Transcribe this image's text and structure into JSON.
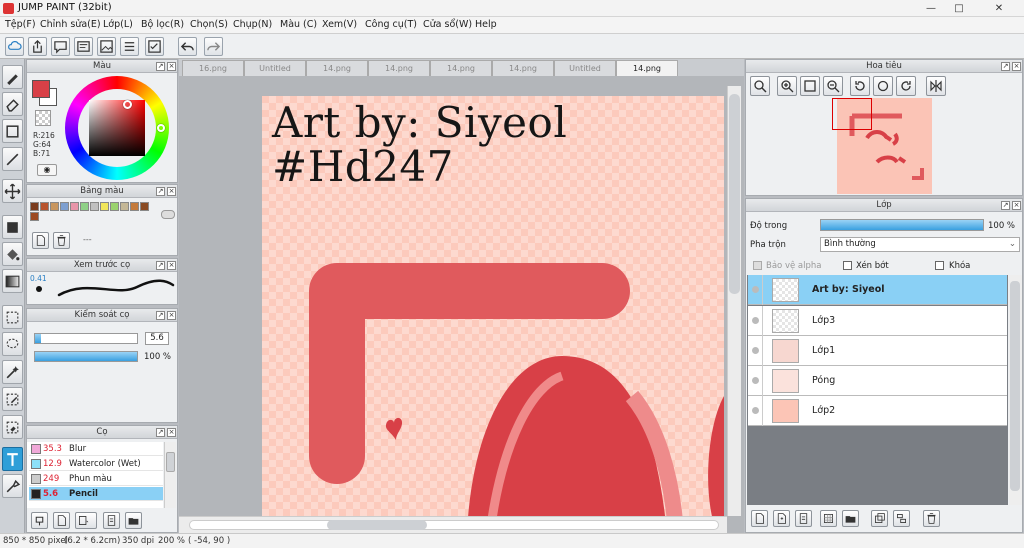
{
  "window": {
    "title": "JUMP PAINT (32bit)"
  },
  "menu": [
    "Tệp(F)",
    "Chỉnh sửa(E)",
    "Lớp(L)",
    "Bộ lọc(R)",
    "Chọn(S)",
    "Chụp(N)",
    "Màu (C)",
    "Xem(V)",
    "Công cụ(T)",
    "Cửa sổ(W)",
    "Help"
  ],
  "tabs": [
    "16.png",
    "Untitled",
    "14.png",
    "14.png",
    "14.png",
    "14.png",
    "Untitled",
    "14.png"
  ],
  "active_tab_index": 7,
  "color_panel": {
    "title": "Màu",
    "r": "R:216",
    "g": "G:64",
    "b": "B:71",
    "main_color": "#d84047"
  },
  "palette_panel": {
    "title": "Bảng màu",
    "swatches": [
      "#7a3b1d",
      "#b8542e",
      "#c8965f",
      "#7d9fd0",
      "#e895a9",
      "#8fd187",
      "#c0c0c0",
      "#f1e65a",
      "#9bd36e",
      "#c4b796",
      "#c47a3a",
      "#8a4b24"
    ],
    "dash": "---"
  },
  "brush_preview_panel": {
    "title": "Xem trước cọ",
    "size_label": "0.41"
  },
  "brush_control_panel": {
    "title": "Kiểm soát cọ",
    "size_value": "5.6",
    "opacity_value": "100 %",
    "size_fraction": 0.056,
    "opacity_fraction": 1.0
  },
  "brush_panel": {
    "title": "Cọ",
    "items": [
      {
        "size": "35.3",
        "name": "Blur",
        "color": "#f0a8d8",
        "selected": false
      },
      {
        "size": "12.9",
        "name": "Watercolor (Wet)",
        "color": "#8ce0f8",
        "selected": false
      },
      {
        "size": "249",
        "name": "Phun màu",
        "color": "#cccccc",
        "selected": false
      },
      {
        "size": "5.6",
        "name": "Pencil",
        "color": "#222222",
        "selected": true
      }
    ]
  },
  "artwork": {
    "line1": "Art by: Siyeol",
    "line2": "#Hd247"
  },
  "navigator_panel": {
    "title": "Hoa tiêu"
  },
  "layer_panel": {
    "title": "Lớp",
    "opacity_label": "Độ trong",
    "opacity_value": "100 %",
    "opacity_fraction": 1.0,
    "blend_label": "Pha trộn",
    "blend_value": "Bình thường",
    "protect_alpha": "Bảo vệ alpha",
    "clip": "Xén bớt",
    "lock": "Khóa",
    "layers": [
      {
        "name": "Art by: Siyeol",
        "selected": true
      },
      {
        "name": "Lớp3",
        "selected": false
      },
      {
        "name": "Lớp1",
        "selected": false
      },
      {
        "name": "Póng",
        "selected": false
      },
      {
        "name": "Lớp2",
        "selected": false
      }
    ]
  },
  "status": {
    "size": "850 * 850 pixel",
    "cm": "(6.2 * 6.2cm)",
    "dpi": "350 dpi",
    "zoom": "200 %",
    "coords": "( -54, 90 )"
  }
}
